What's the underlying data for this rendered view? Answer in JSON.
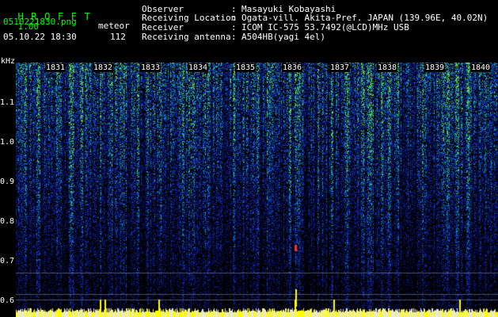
{
  "app": {
    "name": "HROFFT",
    "version": "1.00"
  },
  "meta": {
    "filename": "0510221830.png",
    "datetime": "05.10.22 18:30",
    "mode": "meteor",
    "count": "112"
  },
  "info": [
    {
      "label": "Observer",
      "value": "Masayuki Kobayashi"
    },
    {
      "label": "Receiving Location",
      "value": "Ogata-vill. Akita-Pref. JAPAN (139.96E, 40.02N)"
    },
    {
      "label": "Receiver",
      "value": "ICOM IC-575 53.7492(@LCD)MHz USB"
    },
    {
      "label": "Receiving antenna",
      "value": "A504HB(yagi 4el)"
    }
  ],
  "separator": ":",
  "axis": {
    "freq_unit": "kHz",
    "freq_labels": [
      "1.1",
      "1.0",
      "0.9",
      "0.8",
      "0.7",
      "0.6"
    ],
    "time_labels": [
      "1831",
      "1832",
      "1833",
      "1834",
      "1835",
      "1836",
      "1837",
      "1838",
      "1839",
      "1840"
    ]
  },
  "colors": {
    "background": "#000000",
    "accent_green": "#00ff00",
    "text_white": "#ffffff",
    "signal_yellow": "#ffff00",
    "noise_blue": "#0a1ea0",
    "noise_cyan": "#00c8c8"
  }
}
